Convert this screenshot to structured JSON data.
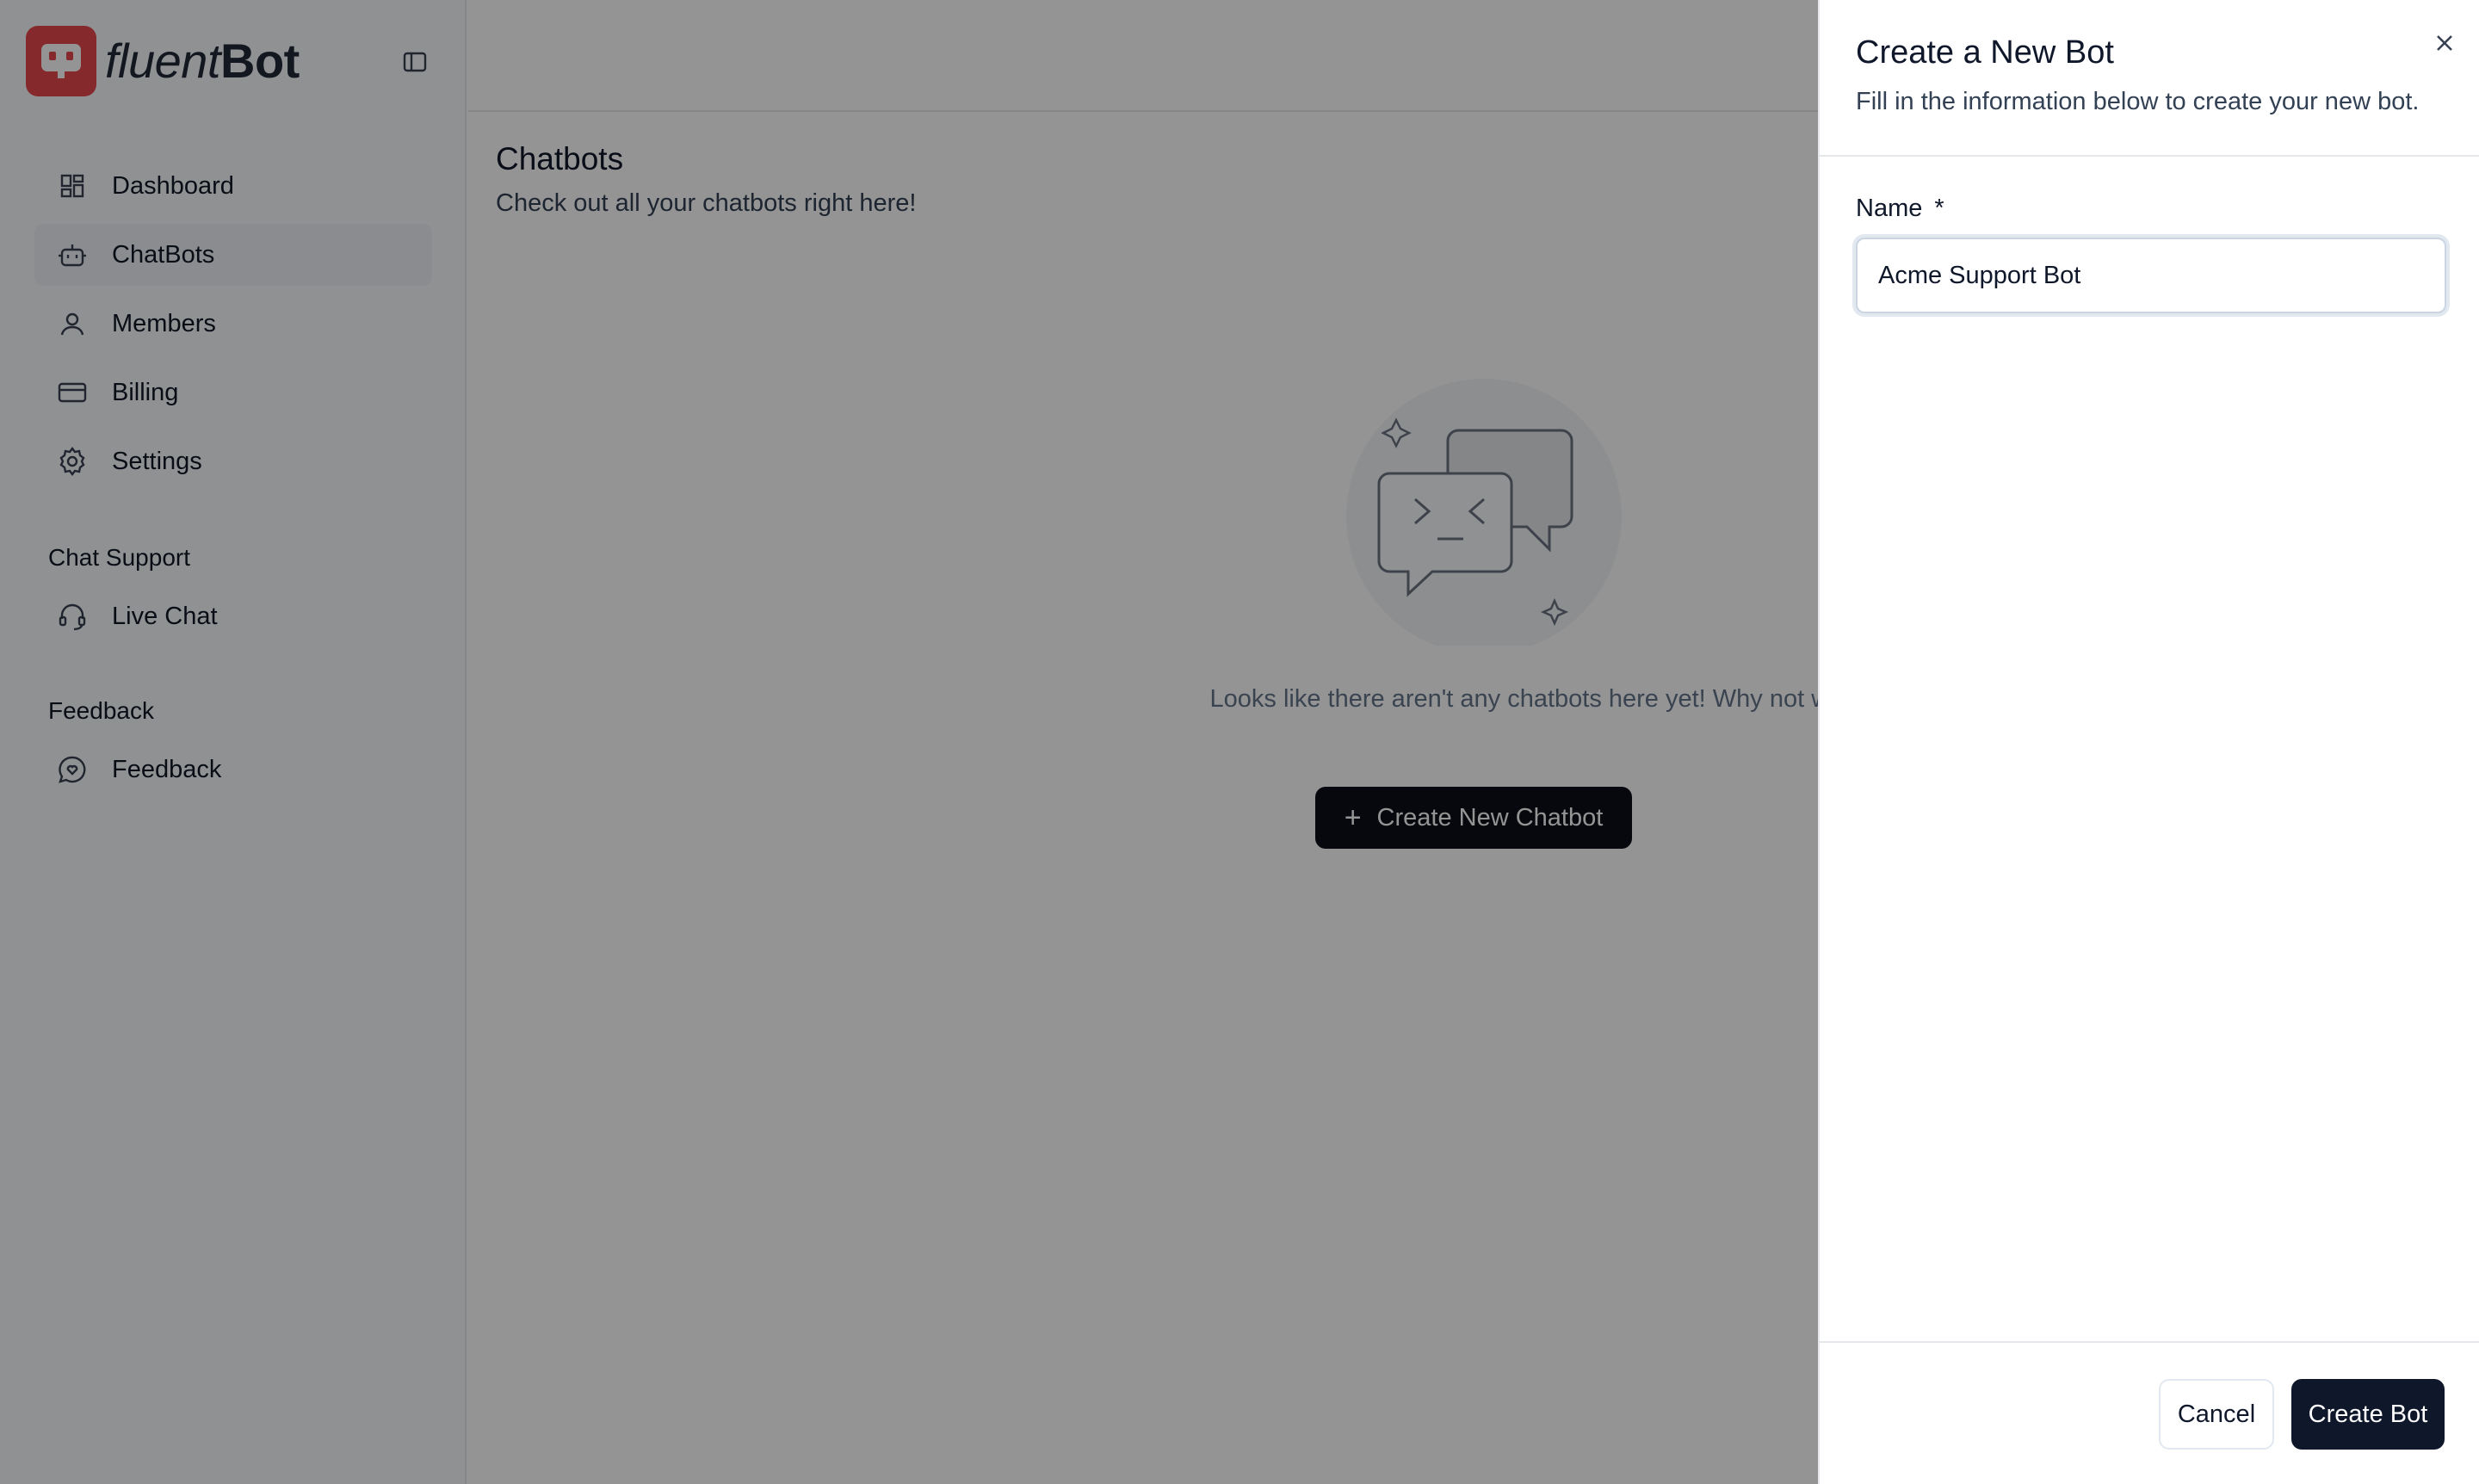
{
  "brand": {
    "name_light": "fluent",
    "name_bold": "Bot",
    "logo_color": "#e5484d",
    "logo_icon": "robot-face-icon"
  },
  "sidebar": {
    "collapse_icon": "sidebar-toggle-icon",
    "items": [
      {
        "label": "Dashboard",
        "icon": "dashboard-icon",
        "active": false
      },
      {
        "label": "ChatBots",
        "icon": "bot-icon",
        "active": true
      },
      {
        "label": "Members",
        "icon": "user-icon",
        "active": false
      },
      {
        "label": "Billing",
        "icon": "credit-card-icon",
        "active": false
      },
      {
        "label": "Settings",
        "icon": "gear-icon",
        "active": false
      }
    ],
    "sections": [
      {
        "title": "Chat Support",
        "items": [
          {
            "label": "Live Chat",
            "icon": "headset-icon"
          }
        ]
      },
      {
        "title": "Feedback",
        "items": [
          {
            "label": "Feedback",
            "icon": "message-heart-icon"
          }
        ]
      }
    ]
  },
  "main": {
    "title": "Chatbots",
    "subtitle": "Check out all your chatbots right here!",
    "empty_state": {
      "text": "Looks like there aren't any chatbots here yet! Why not whip one up right now?",
      "button_label": "Create New Chatbot",
      "button_icon": "plus-icon"
    }
  },
  "drawer": {
    "title": "Create a New Bot",
    "subtitle": "Fill in the information below to create your new bot.",
    "close_icon": "close-icon",
    "field": {
      "label": "Name",
      "required_mark": "*",
      "value": "Acme Support Bot"
    },
    "cancel_label": "Cancel",
    "submit_label": "Create Bot"
  }
}
